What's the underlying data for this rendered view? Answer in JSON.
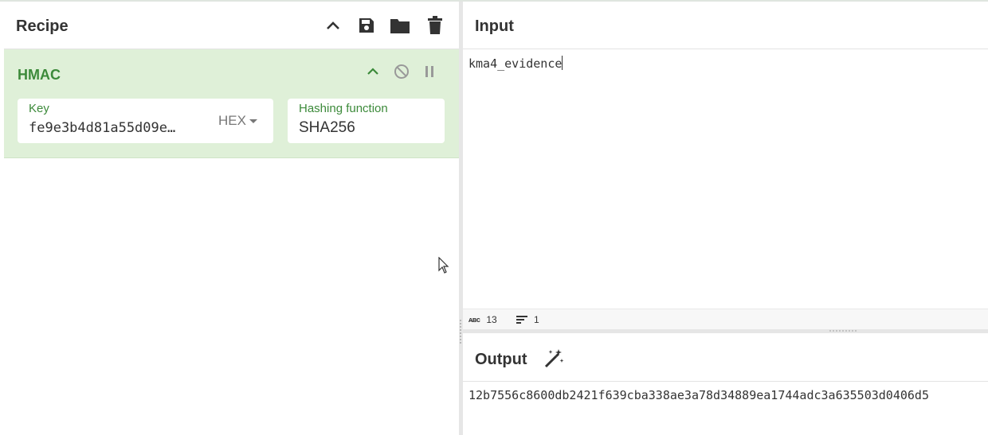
{
  "recipe": {
    "title": "Recipe",
    "operation": {
      "name": "HMAC",
      "key": {
        "label": "Key",
        "value": "fe9e3b4d81a55d09e…",
        "format": "HEX"
      },
      "hash": {
        "label": "Hashing function",
        "value": "SHA256"
      }
    }
  },
  "input": {
    "title": "Input",
    "text": "kma4_evidence",
    "status": {
      "chars": "13",
      "lines": "1"
    }
  },
  "output": {
    "title": "Output",
    "text": "12b7556c8600db2421f639cba338ae3a78d34889ea1744adc3a635503d0406d5"
  },
  "colors": {
    "accent_green": "#3c8a3a",
    "op_background": "#dff0d8"
  }
}
